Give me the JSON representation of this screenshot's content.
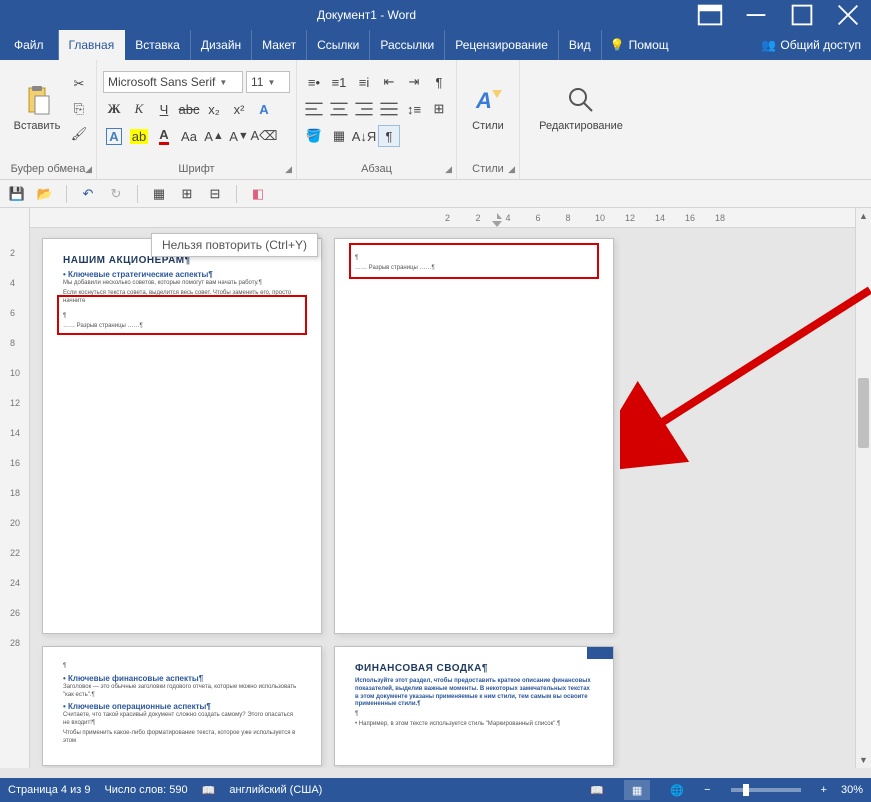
{
  "title": "Документ1 - Word",
  "tabs": {
    "file": "Файл",
    "home": "Главная",
    "insert": "Вставка",
    "design": "Дизайн",
    "layout": "Макет",
    "references": "Ссылки",
    "mailings": "Рассылки",
    "review": "Рецензирование",
    "view": "Вид",
    "tellme": "Помощ",
    "share": "Общий доступ"
  },
  "ribbon": {
    "clipboard": {
      "label": "Буфер обмена",
      "paste": "Вставить"
    },
    "font": {
      "label": "Шрифт",
      "name": "Microsoft Sans Serif",
      "size": "11"
    },
    "paragraph": {
      "label": "Абзац"
    },
    "styles": {
      "label": "Стили",
      "button": "Стили"
    },
    "editing": {
      "label": "",
      "button": "Редактирование"
    }
  },
  "tooltip": "Нельзя повторить (Ctrl+Y)",
  "ruler_v": [
    "2",
    "4",
    "6",
    "8",
    "10",
    "12",
    "14",
    "16",
    "18",
    "20",
    "22",
    "24",
    "26",
    "28"
  ],
  "ruler_h": [
    "2",
    "2",
    "4",
    "6",
    "8",
    "10",
    "12",
    "14",
    "16",
    "18"
  ],
  "tab_marker": "L",
  "pages": {
    "p1": {
      "heading": "НАШИМ АКЦИОНЕРАМ¶",
      "bullet1": "• Ключевые стратегические аспекты¶",
      "line1": "Мы добавили несколько советов, которые помогут вам начать работу.¶",
      "line2": "Если коснуться текста совета, выделится весь совет. Чтобы заменить его, просто начните",
      "break": "…… Разрыв страницы ……¶"
    },
    "p2": {
      "break": "…… Разрыв страницы ……¶"
    },
    "p3": {
      "bullet1": "• Ключевые финансовые аспекты¶",
      "line1": "Заголовок — это обычные заголовки годового отчета, которые можно использовать \"как есть\".¶",
      "bullet2": "• Ключевые операционные аспекты¶",
      "line2": "Считаете, что такой красивый документ сложно создать самому? Этого опасаться не входит!¶",
      "line3": "Чтобы применить какое-либо форматирование текста, которое уже используется в этом"
    },
    "p4": {
      "heading": "ФИНАНСОВАЯ СВОДКА¶",
      "line1": "Используйте этот раздел, чтобы предоставить краткое описание финансовых показателей, выделив важные моменты. В некоторых замечательных текстах в этом документе указаны применяемые к ним стили, тем самым вы освоите примененные стили.¶",
      "line2": "• Например, в этом тексте используется стиль \"Маркированный список\".¶"
    }
  },
  "statusbar": {
    "page": "Страница 4 из 9",
    "words": "Число слов: 590",
    "lang": "английский (США)",
    "zoom": "30%"
  }
}
